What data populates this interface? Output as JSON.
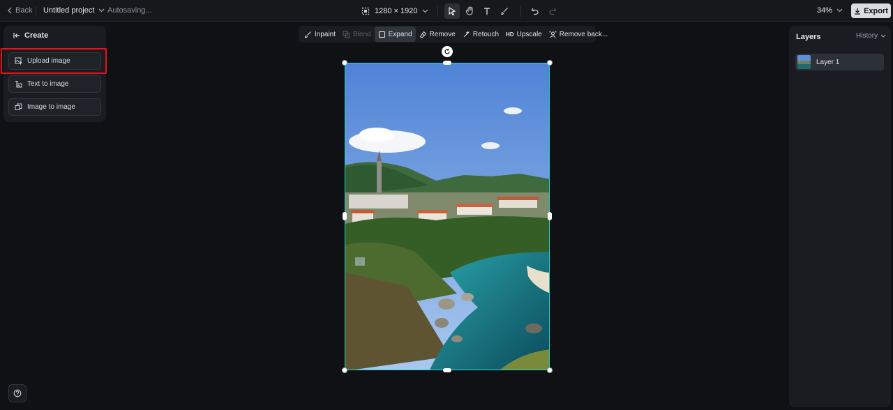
{
  "topbar": {
    "back_label": "Back",
    "project_name": "Untitled project",
    "status": "Autosaving...",
    "canvas_size": "1280 × 1920",
    "zoom": "34%",
    "export_label": "Export"
  },
  "tools": [
    {
      "name": "select-tool",
      "icon": "cursor-icon",
      "active": true
    },
    {
      "name": "hand-tool",
      "icon": "hand-icon",
      "active": false
    },
    {
      "name": "text-tool",
      "icon": "text-icon",
      "active": false
    },
    {
      "name": "brush-tool",
      "icon": "brush-icon",
      "active": false
    },
    {
      "name": "undo",
      "icon": "undo-icon",
      "active": false
    },
    {
      "name": "redo",
      "icon": "redo-icon",
      "active": false,
      "disabled": true
    }
  ],
  "create_panel": {
    "title": "Create",
    "buttons": [
      {
        "label": "Upload image",
        "icon": "upload-image-icon"
      },
      {
        "label": "Text to image",
        "icon": "text-to-image-icon"
      },
      {
        "label": "Image to image",
        "icon": "image-to-image-icon"
      }
    ],
    "highlight_color": "#e3141d"
  },
  "edit_toolbar": {
    "inpaint": "Inpaint",
    "blend": "Blend",
    "expand": "Expand",
    "remove": "Remove",
    "retouch": "Retouch",
    "upscale_badge": "HD",
    "upscale": "Upscale",
    "remove_background": "Remove back..."
  },
  "layers_panel": {
    "title": "Layers",
    "history_label": "History",
    "layers": [
      {
        "name": "Layer 1"
      }
    ]
  },
  "colors": {
    "accent_selection": "#2fd0d0",
    "background": "#0f1115",
    "panel": "#1a1c21"
  }
}
